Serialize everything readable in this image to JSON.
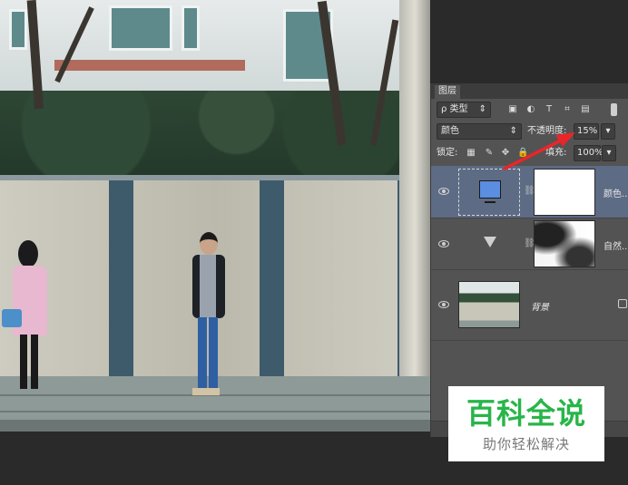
{
  "panel": {
    "tab_label": "图层",
    "filter_kind": "ρ 类型",
    "blend_mode": "颜色",
    "opacity_label": "不透明度:",
    "opacity_value": "15%",
    "lock_label": "锁定:",
    "fill_label": "填充:",
    "fill_value": "100%",
    "layers": [
      {
        "name": "颜色...",
        "thumb_color": "#5b8de0",
        "type": "fill"
      },
      {
        "name": "自然...",
        "type": "adjustment"
      },
      {
        "name": "背景",
        "type": "background"
      }
    ]
  },
  "watermark": {
    "title": "百科全说",
    "subtitle": "助你轻松解决"
  },
  "colors": {
    "panel_bg": "#535353",
    "selected_layer": "#5d6b84",
    "arrow": "#e8262a",
    "watermark_green": "#28b54a"
  }
}
